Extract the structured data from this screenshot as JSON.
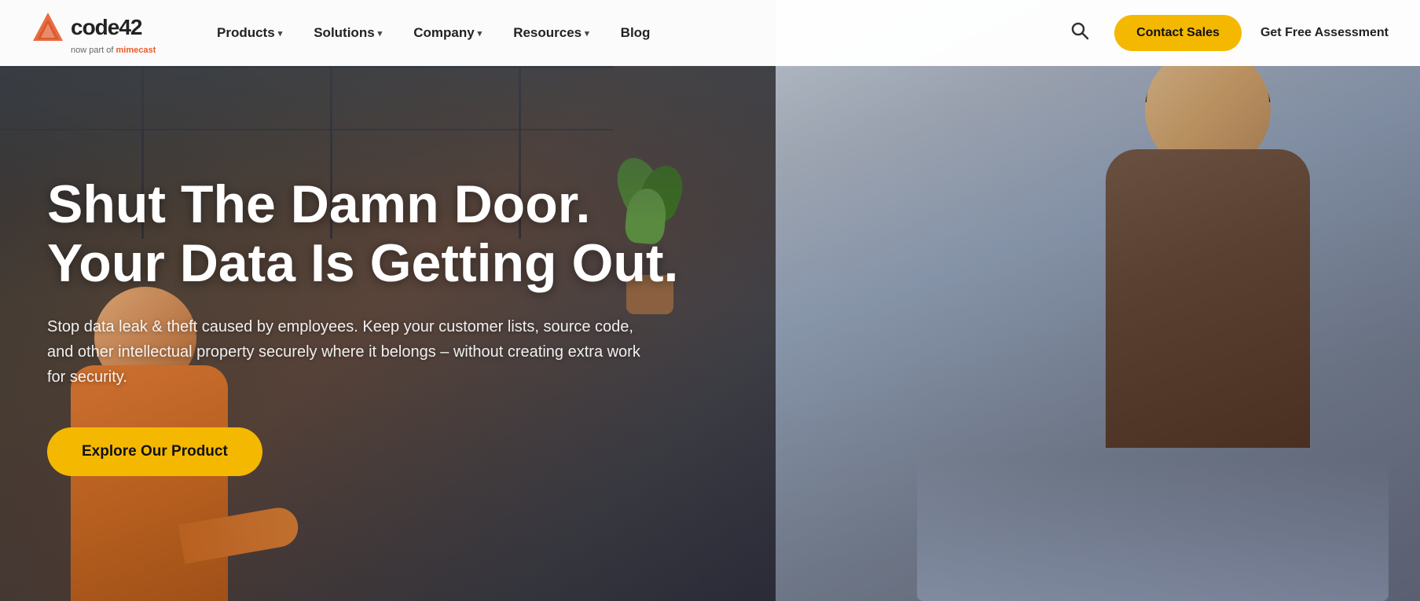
{
  "brand": {
    "logo_text": "code42",
    "logo_subtitle": "now part of",
    "logo_subtitle_brand": "mimecast"
  },
  "navbar": {
    "links": [
      {
        "label": "Products",
        "has_dropdown": true
      },
      {
        "label": "Solutions",
        "has_dropdown": true
      },
      {
        "label": "Company",
        "has_dropdown": true
      },
      {
        "label": "Resources",
        "has_dropdown": true
      },
      {
        "label": "Blog",
        "has_dropdown": false
      }
    ],
    "contact_sales_label": "Contact Sales",
    "free_assessment_label": "Get Free Assessment"
  },
  "hero": {
    "headline_line1": "Shut The Damn Door.",
    "headline_line2": "Your Data Is Getting Out.",
    "subtext": "Stop data leak & theft caused by employees. Keep your customer lists, source code, and other intellectual property securely where it belongs – without creating extra work for security.",
    "cta_label": "Explore Our Product"
  },
  "colors": {
    "accent_yellow": "#f5b800",
    "accent_orange": "#e85c2c",
    "text_dark": "#222222",
    "white": "#ffffff"
  }
}
